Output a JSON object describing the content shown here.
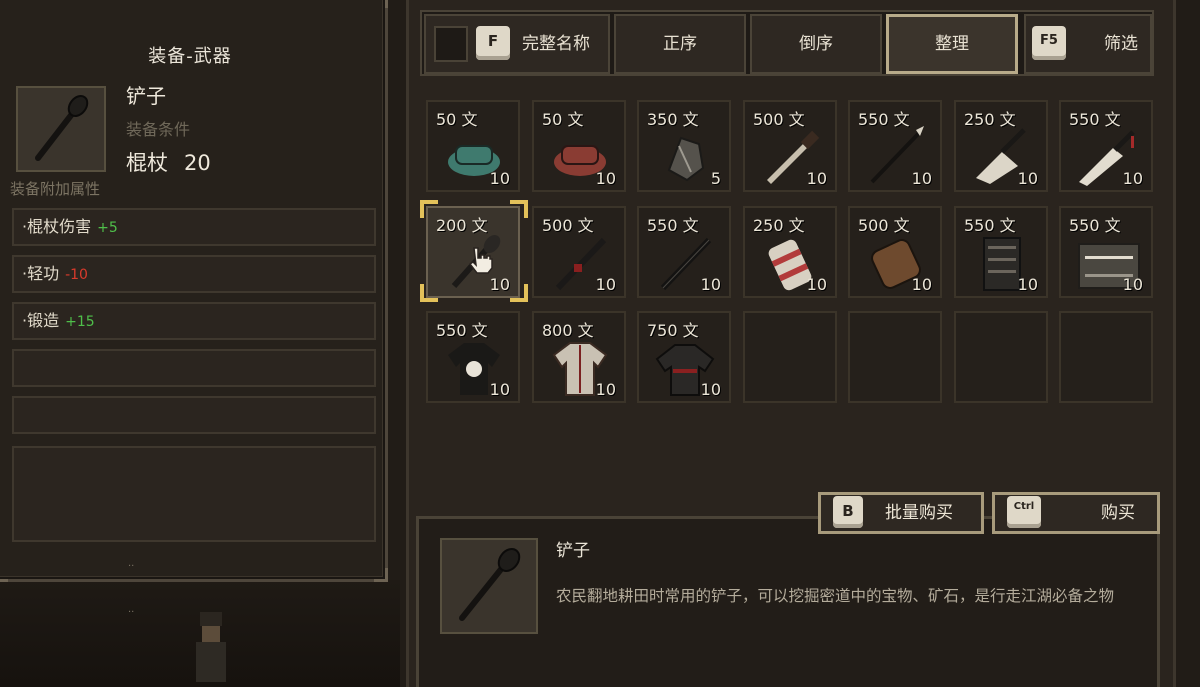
{
  "equip_panel": {
    "title": "装备-武器",
    "item_name": "铲子",
    "item_condition": "装备条件",
    "stat_label": "棍杖",
    "stat_value": "20",
    "attr_heading": "装备附加属性",
    "attrs": [
      {
        "label": "·棍杖伤害",
        "value": "+5",
        "type": "plus"
      },
      {
        "label": "·轻功",
        "value": "-10",
        "type": "minus"
      },
      {
        "label": "·锻造",
        "value": "+15",
        "type": "plus"
      }
    ],
    "dots_1": "..",
    "dots_2": ".."
  },
  "tabs": {
    "full_name_key": "F",
    "full_name": "完整名称",
    "asc": "正序",
    "desc": "倒序",
    "organize": "整理",
    "filter_key": "F5",
    "filter": "筛选"
  },
  "items": [
    {
      "price": "50 文",
      "qty": "10",
      "icon": "teal-cap-icon",
      "color": "#3f7a6e"
    },
    {
      "price": "50 文",
      "qty": "10",
      "icon": "red-cap-icon",
      "color": "#8a3c33"
    },
    {
      "price": "350 文",
      "qty": "5",
      "icon": "dark-ore-icon",
      "color": "#55524c"
    },
    {
      "price": "500 文",
      "qty": "10",
      "icon": "dagger-icon",
      "color": "#c8bfae"
    },
    {
      "price": "550 文",
      "qty": "10",
      "icon": "spear-icon",
      "color": "#d8d2c4"
    },
    {
      "price": "250 文",
      "qty": "10",
      "icon": "cleaver-icon",
      "color": "#dcd6c8"
    },
    {
      "price": "550 文",
      "qty": "10",
      "icon": "broadsword-icon",
      "color": "#e2dccf"
    },
    {
      "price": "200 文",
      "qty": "10",
      "icon": "shovel-icon",
      "color": "#1c1a18",
      "selected": true
    },
    {
      "price": "500 文",
      "qty": "10",
      "icon": "staff-red-icon",
      "color": "#1b1918"
    },
    {
      "price": "550 文",
      "qty": "10",
      "icon": "black-staff-icon",
      "color": "#141312"
    },
    {
      "price": "250 文",
      "qty": "10",
      "icon": "red-bracer-icon",
      "color": "#b23b3b"
    },
    {
      "price": "500 文",
      "qty": "10",
      "icon": "leather-bracer-icon",
      "color": "#6e4a2e"
    },
    {
      "price": "550 文",
      "qty": "10",
      "icon": "dark-vest-icon",
      "color": "#2b2926"
    },
    {
      "price": "550 文",
      "qty": "10",
      "icon": "armor-plate-icon",
      "color": "#4a4740"
    },
    {
      "price": "550 文",
      "qty": "10",
      "icon": "black-robe-icon",
      "color": "#1a1917"
    },
    {
      "price": "800 文",
      "qty": "10",
      "icon": "white-robe-icon",
      "color": "#c9c1b3"
    },
    {
      "price": "750 文",
      "qty": "10",
      "icon": "dark-coat-icon",
      "color": "#2a2826"
    }
  ],
  "actions": {
    "bulk_key": "B",
    "bulk_buy": "批量购买",
    "buy_key": "Ctrl",
    "buy": "购买"
  },
  "description": {
    "name": "铲子",
    "text": "农民翻地耕田时常用的铲子，可以挖掘密道中的宝物、矿石，是行走江湖必备之物"
  }
}
